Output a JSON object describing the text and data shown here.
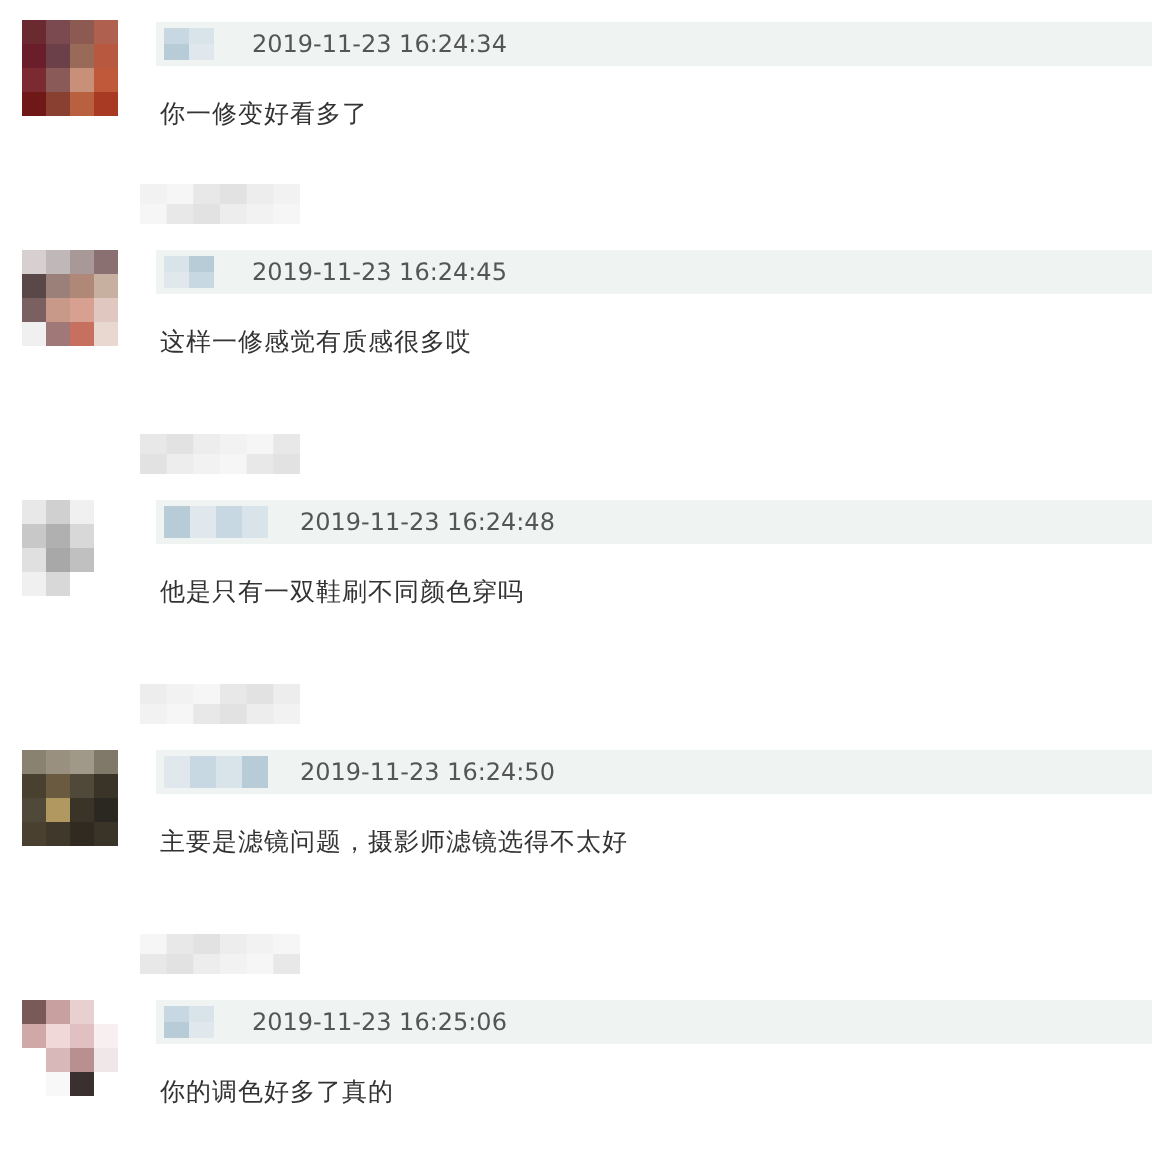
{
  "comments": [
    {
      "kind": "short-name",
      "time": "2019-11-23 16:24:34",
      "text": "你一修变好看多了"
    },
    {
      "kind": "short-name",
      "time": "2019-11-23 16:24:45",
      "text": "这样一修感觉有质感很多哎"
    },
    {
      "kind": "long-name",
      "time": "2019-11-23 16:24:48",
      "text": "他是只有一双鞋刷不同颜色穿吗"
    },
    {
      "kind": "long-name",
      "time": "2019-11-23 16:24:50",
      "text": "主要是滤镜问题，摄影师滤镜选得不太好"
    },
    {
      "kind": "short-name",
      "time": "2019-11-23 16:25:06",
      "text": "你的调色好多了真的"
    }
  ]
}
